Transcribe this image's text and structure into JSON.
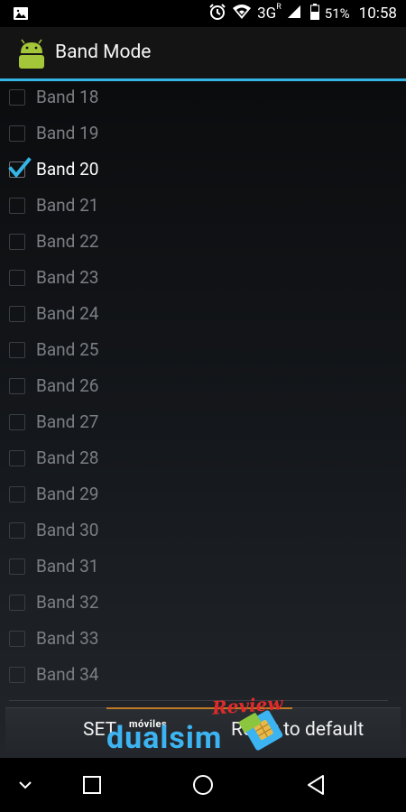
{
  "status_bar": {
    "network": "3G",
    "roaming": "R",
    "battery": "51%",
    "time": "10:58",
    "icons": [
      "image-notification-icon",
      "alarm-icon",
      "wifi-icon",
      "signal-icon",
      "battery-icon"
    ]
  },
  "action_bar": {
    "title": "Band Mode",
    "icon": "android-icon"
  },
  "bands": [
    {
      "label": "Band 18",
      "checked": false
    },
    {
      "label": "Band 19",
      "checked": false
    },
    {
      "label": "Band 20",
      "checked": true
    },
    {
      "label": "Band 21",
      "checked": false
    },
    {
      "label": "Band 22",
      "checked": false
    },
    {
      "label": "Band 23",
      "checked": false
    },
    {
      "label": "Band 24",
      "checked": false
    },
    {
      "label": "Band 25",
      "checked": false
    },
    {
      "label": "Band 26",
      "checked": false
    },
    {
      "label": "Band 27",
      "checked": false
    },
    {
      "label": "Band 28",
      "checked": false
    },
    {
      "label": "Band 29",
      "checked": false
    },
    {
      "label": "Band 30",
      "checked": false
    },
    {
      "label": "Band 31",
      "checked": false
    },
    {
      "label": "Band 32",
      "checked": false
    },
    {
      "label": "Band 33",
      "checked": false
    },
    {
      "label": "Band 34",
      "checked": false
    }
  ],
  "buttons": {
    "set_label": "SET",
    "reset_label": "Reset to default"
  },
  "watermark": {
    "moviles": "móviles",
    "brand": "dualsim",
    "review": "Review"
  },
  "nav_bar": {
    "icons": [
      "chevron-down-icon",
      "recents-icon",
      "home-icon",
      "back-icon"
    ]
  },
  "colors": {
    "accent": "#33b5e5",
    "check": "#33b5e5",
    "label_unchecked": "#7b7f84",
    "label_checked": "#ffffff"
  }
}
